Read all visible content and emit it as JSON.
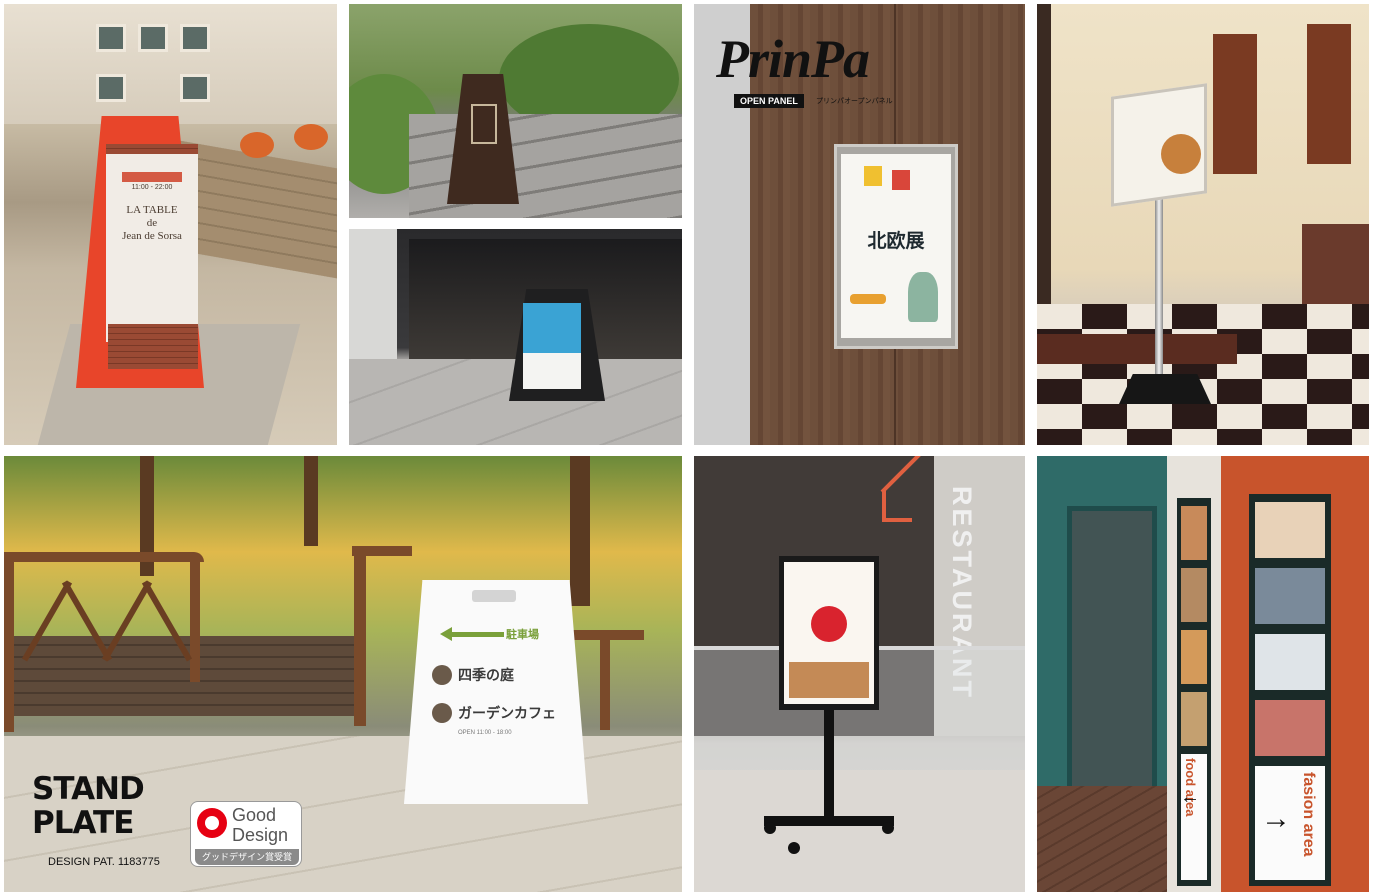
{
  "panels": {
    "aframe_red": {
      "sign_hours": "11:00 - 22:00",
      "sign_name_line1": "LA TABLE",
      "sign_name_line2": "de",
      "sign_name_line3": "Jean de Sorsa"
    },
    "prinpa": {
      "logo": "PrinPa",
      "logo_tag": "OPEN PANEL",
      "logo_sub": "プリンパオープンパネル",
      "poster_title": "北欧展"
    },
    "stand_plate": {
      "arrow_label": "駐車場",
      "item1": "四季の庭",
      "item2": "ガーデンカフェ",
      "item2_sub": "OPEN 11:00 - 18:00",
      "logo_line1": "STAND",
      "logo_line2": "PLATE",
      "patent": "DESIGN PAT. 1183775",
      "good_design": "Good Design",
      "good_design_award": "グッドデザイン賞受賞"
    },
    "restaurant": {
      "wall_text": "RESTAURANT"
    },
    "fashion": {
      "food_label": "food area",
      "fashion_label": "fasion area"
    }
  },
  "colors": {
    "red_sign": "#e8452a",
    "good_design_red": "#e60012",
    "accent_green": "#7aa03a",
    "orange_wall": "#c8542c"
  }
}
